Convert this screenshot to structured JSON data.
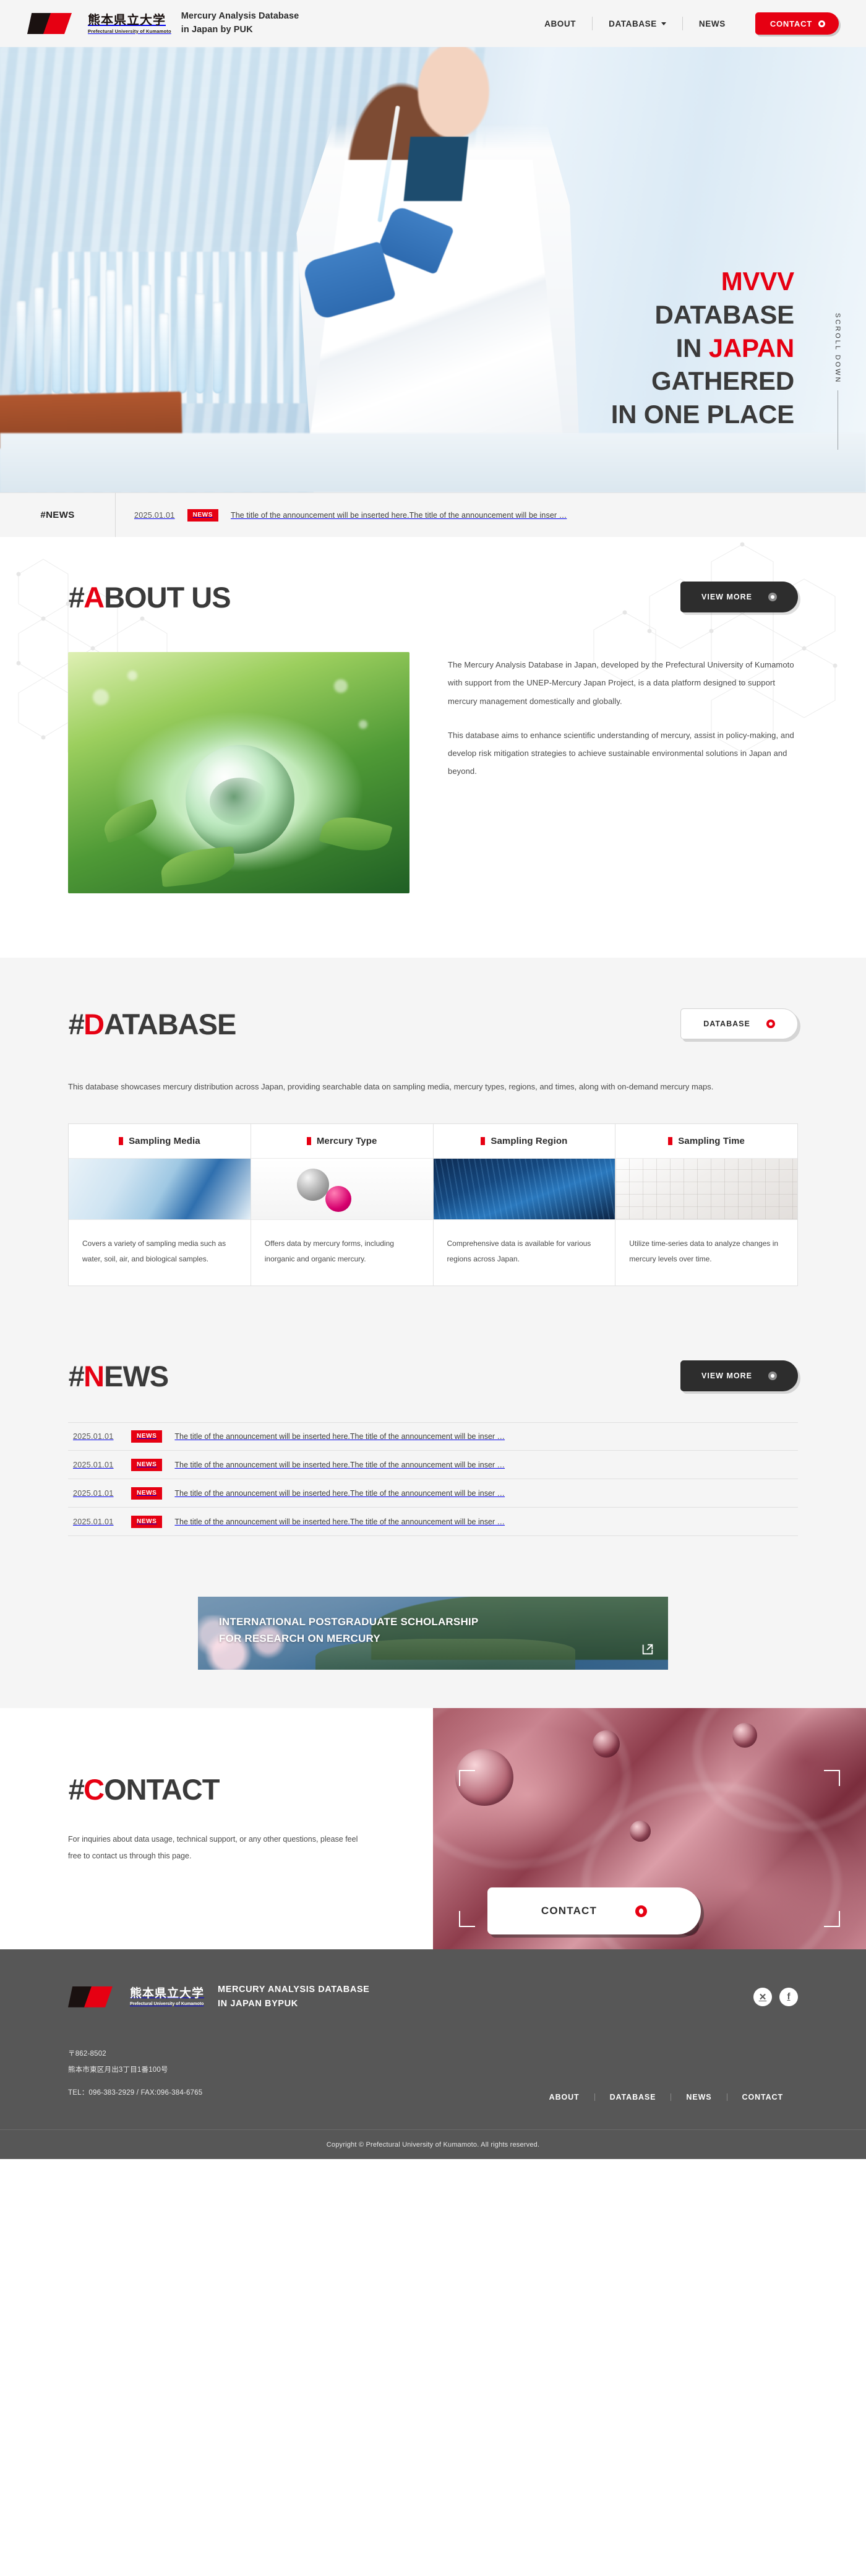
{
  "header": {
    "logo_kanji": "熊本県立大学",
    "logo_roman": "Prefectural University of Kumamoto",
    "site_title_line1": "Mercury Analysis Database",
    "site_title_line2": "in Japan by PUK",
    "nav": [
      {
        "label": "ABOUT",
        "has_caret": false
      },
      {
        "label": "DATABASE",
        "has_caret": true
      },
      {
        "label": "NEWS",
        "has_caret": false
      }
    ],
    "contact_label": "CONTACT"
  },
  "hero": {
    "line1": "MVVV",
    "line2": "DATABASE",
    "line3_plain": "IN ",
    "line3_hl": "JAPAN",
    "line4": "GATHERED",
    "line5": "IN ONE PLACE",
    "scroll_text": "SCROLL  DOWN",
    "accent": "#e60012"
  },
  "ticker": {
    "tag": "#NEWS",
    "date": "2025.01.01",
    "badge": "NEWS",
    "title": "The title of the announcement will be inserted here.The title of the announcement will be inser …"
  },
  "about": {
    "title_hash": "#",
    "title_first": "A",
    "title_rest": "BOUT US",
    "view_more": "VIEW MORE",
    "paragraphs": [
      "The Mercury Analysis Database in Japan, developed by the Prefectural University of Kumamoto with support from the UNEP-Mercury Japan Project, is a data platform designed to support mercury management domestically and globally.",
      "This database aims to enhance scientific understanding of mercury, assist in policy-making, and develop risk mitigation strategies to achieve sustainable environmental solutions in Japan and beyond."
    ]
  },
  "database": {
    "title_hash": "#",
    "title_first": "D",
    "title_rest": "ATABASE",
    "button_label": "DATABASE",
    "description": "This database showcases mercury distribution across Japan, providing searchable data on sampling media, mercury types, regions, and times, along with on-demand mercury maps.",
    "cards": [
      {
        "title": "Sampling Media",
        "desc": "Covers a variety of sampling media such as water, soil, air, and biological samples."
      },
      {
        "title": "Mercury Type",
        "desc": "Offers data by mercury forms, including inorganic and organic mercury."
      },
      {
        "title": "Sampling Region",
        "desc": "Comprehensive data is available for various regions across Japan."
      },
      {
        "title": "Sampling Time",
        "desc": "Utilize time-series data to analyze changes in mercury levels over time."
      }
    ]
  },
  "news": {
    "title_hash": "#",
    "title_first": "N",
    "title_rest": "EWS",
    "view_more": "VIEW MORE",
    "items": [
      {
        "date": "2025.01.01",
        "badge": "NEWS",
        "title": "The title of the announcement will be inserted here.The title of the announcement will be inser …"
      },
      {
        "date": "2025.01.01",
        "badge": "NEWS",
        "title": "The title of the announcement will be inserted here.The title of the announcement will be inser …"
      },
      {
        "date": "2025.01.01",
        "badge": "NEWS",
        "title": "The title of the announcement will be inserted here.The title of the announcement will be inser …"
      },
      {
        "date": "2025.01.01",
        "badge": "NEWS",
        "title": "The title of the announcement will be inserted here.The title of the announcement will be inser …"
      }
    ]
  },
  "banner": {
    "line1": "INTERNATIONAL POSTGRADUATE SCHOLARSHIP",
    "line2": "FOR RESEARCH ON MERCURY"
  },
  "contact": {
    "title_hash": "#",
    "title_first": "C",
    "title_rest": "ONTACT",
    "description": "For inquiries about data usage, technical support, or any other questions, please feel free to contact us through this page.",
    "cta_label": "CONTACT"
  },
  "footer": {
    "logo_kanji": "熊本県立大学",
    "logo_roman": "Prefectural University of Kumamoto",
    "name_line1": "MERCURY ANALYSIS DATABASE",
    "name_line2": "IN JAPAN BYPUK",
    "social": [
      {
        "name": "x-twitter",
        "glyph": "✕"
      },
      {
        "name": "facebook",
        "glyph": "f"
      }
    ],
    "postal": "〒862-8502",
    "address": "熊本市東区月出3丁目1番100号",
    "tel_fax": "TEL：096-383-2929 / FAX:096-384-6765",
    "nav": [
      "ABOUT",
      "DATABASE",
      "NEWS",
      "CONTACT"
    ],
    "copyright": "Copyright © Prefectural University of Kumamoto. All rights reserved."
  }
}
